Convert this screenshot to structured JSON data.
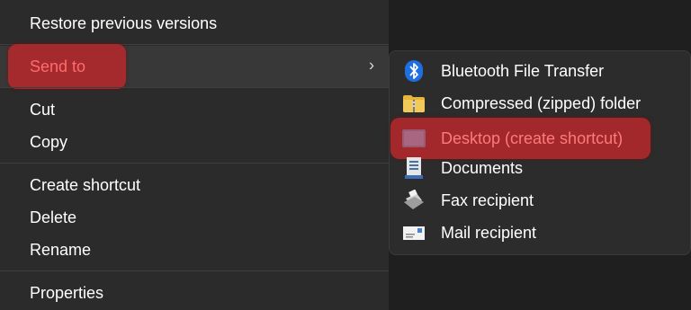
{
  "context_menu": {
    "items": [
      {
        "label": "Restore previous versions"
      },
      {
        "label": "Send to",
        "has_submenu": true,
        "chevron": "›"
      },
      {
        "label": "Cut"
      },
      {
        "label": "Copy"
      },
      {
        "label": "Create shortcut"
      },
      {
        "label": "Delete"
      },
      {
        "label": "Rename"
      },
      {
        "label": "Properties"
      }
    ]
  },
  "send_to_submenu": {
    "items": [
      {
        "label": "Bluetooth File Transfer",
        "icon": "bluetooth-icon"
      },
      {
        "label": "Compressed (zipped) folder",
        "icon": "zip-folder-icon"
      },
      {
        "label": "Desktop (create shortcut)",
        "icon": "desktop-icon",
        "highlighted": true
      },
      {
        "label": "Documents",
        "icon": "documents-icon"
      },
      {
        "label": "Fax recipient",
        "icon": "fax-icon"
      },
      {
        "label": "Mail recipient",
        "icon": "mail-icon"
      }
    ]
  },
  "colors": {
    "menu_bg": "#2b2b2b",
    "text": "#ffffff",
    "highlight": "#b9282d",
    "highlight_text": "#ff6b6b",
    "bluetooth": "#1f6fe0",
    "folder": "#e8b53b"
  }
}
